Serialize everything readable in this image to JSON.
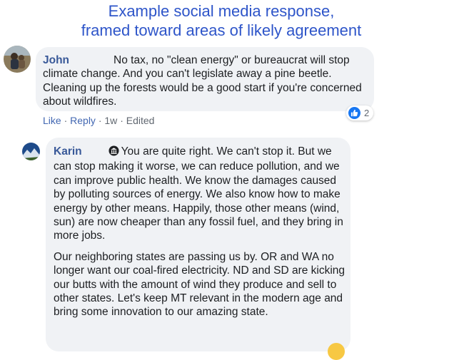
{
  "headline": {
    "line1": "Example social media response,",
    "line2": "framed toward areas of likely agreement"
  },
  "comment1": {
    "author": "John",
    "text_first": "No tax, no \"clean energy\" or bureaucrat will stop",
    "text_rest": "climate change. And you can't legislate away a pine beetle. Cleaning up the forests would be a good start if you're concerned about wildfires.",
    "actions": {
      "like": "Like",
      "reply": "Reply",
      "time": "1w",
      "edited": "Edited"
    },
    "reactions": {
      "icon": "thumbs-up-icon",
      "count": "2",
      "color": "#1877f2"
    }
  },
  "comment2": {
    "author": "Karin",
    "badge_icon": "top-fan-badge-icon",
    "para1": "You are quite right. We can't stop it. But we can stop making it worse, we can reduce pollution, and we can improve public health. We know the damages caused by polluting sources of energy. We also know how to make energy by other means. Happily, those other means (wind, sun) are now cheaper than any fossil fuel, and they bring in more jobs.",
    "para2": "Our neighboring states are passing us by. OR and WA no longer want our coal-fired electricity. ND and SD are kicking our butts with the amount of wind they produce and sell to other states. Let's keep MT relevant in the modern age and bring some innovation to our amazing state."
  },
  "colors": {
    "headline": "#2e55c9",
    "author": "#385898",
    "bubble": "#f0f2f5",
    "link": "#4267b2"
  }
}
